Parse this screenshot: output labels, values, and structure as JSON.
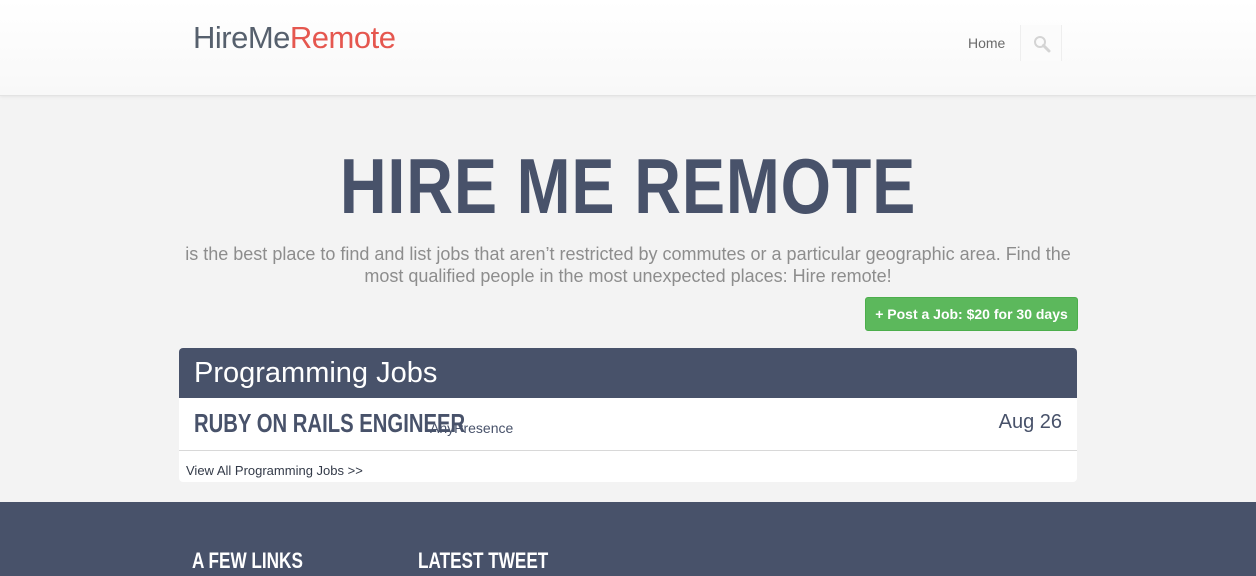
{
  "header": {
    "logo_part1": "HireMe",
    "logo_part2": "Remote",
    "nav_home": "Home",
    "search_icon": "search-icon"
  },
  "hero": {
    "title": "HIRE ME REMOTE",
    "subtitle": "is the best place to find and list jobs that aren’t restricted by commutes or a particular geographic area. Find the most qualified people in the most unexpected places: Hire remote!",
    "post_button": "+ Post a Job: $20 for 30 days"
  },
  "jobs_section": {
    "heading": "Programming Jobs",
    "jobs": [
      {
        "title": "RUBY ON RAILS ENGINEER",
        "company": "AnyPresence",
        "date": "Aug 26"
      }
    ],
    "view_all": "View All Programming Jobs >>"
  },
  "footer": {
    "links_heading": "A FEW LINKS",
    "tweet_heading": "LATEST TWEET"
  },
  "colors": {
    "brand_navy": "#48526a",
    "accent_red": "#e5574f",
    "button_green": "#5cb85c",
    "page_bg": "#f3f3f3"
  }
}
